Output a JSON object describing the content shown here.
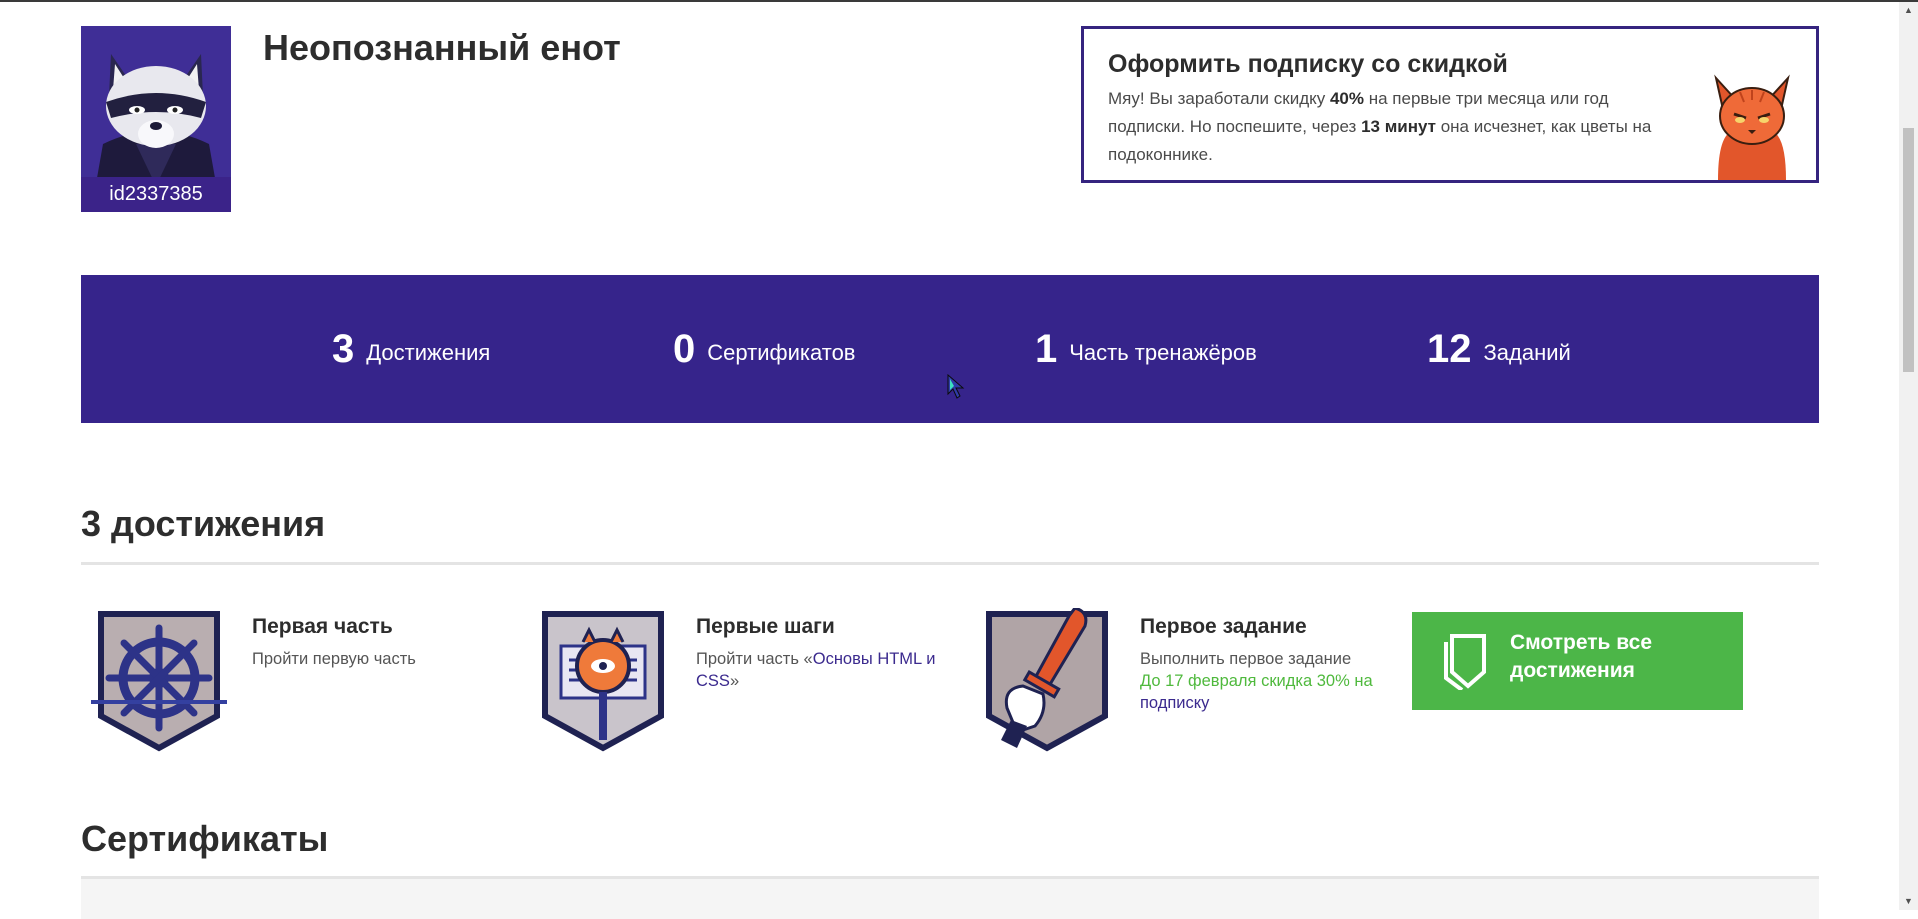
{
  "profile": {
    "username": "Неопознанный енот",
    "user_id": "id2337385"
  },
  "promo": {
    "title": "Оформить подписку со скидкой",
    "text_1": "Мяу! Вы заработали скидку ",
    "discount": "40%",
    "text_2": " на первые три месяца или год подписки. Но поспешите, через ",
    "time_left": "13 минут",
    "text_3": " она исчезнет, как цветы на подоконнике."
  },
  "stats": [
    {
      "value": "3",
      "label": "Достижения"
    },
    {
      "value": "0",
      "label": "Сертификатов"
    },
    {
      "value": "1",
      "label": "Часть тренажёров"
    },
    {
      "value": "12",
      "label": "Заданий"
    }
  ],
  "achievements_section": {
    "title": "3 достижения",
    "items": [
      {
        "title": "Первая часть",
        "description": "Пройти первую часть"
      },
      {
        "title": "Первые шаги",
        "description_prefix": "Пройти часть «",
        "link": "Основы HTML и CSS",
        "description_suffix": "»"
      },
      {
        "title": "Первое задание",
        "description": "Выполнить первое задание",
        "promo_text": "До 17 февраля скидка 30% на ",
        "promo_link": "подписку"
      }
    ],
    "view_all_label": "Смотреть все достижения"
  },
  "certificates_section": {
    "title": "Сертификаты"
  },
  "colors": {
    "brand_purple": "#36248b",
    "accent_green": "#4cb648",
    "badge_orange": "#e2562b"
  }
}
